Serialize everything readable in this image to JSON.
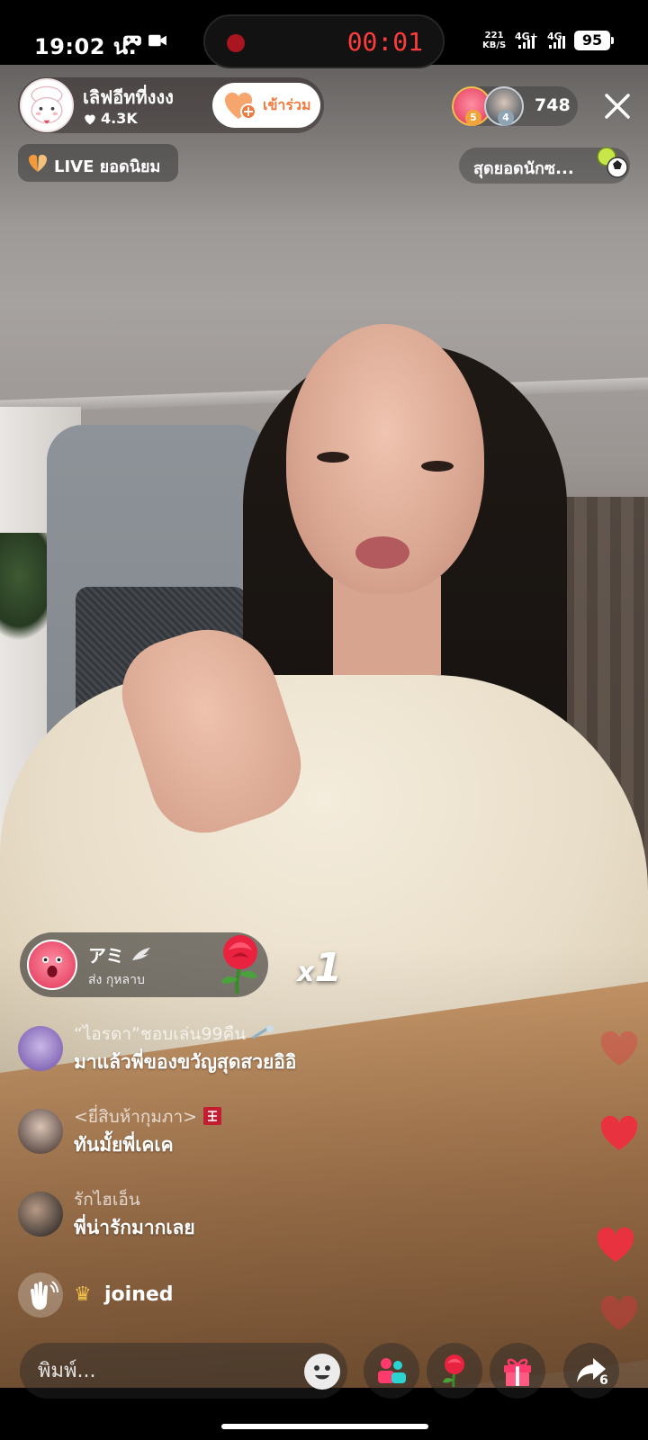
{
  "status_bar": {
    "time": "19:02 น.",
    "recording_time": "00:01",
    "net_speed_value": "221",
    "net_speed_unit": "KB/S",
    "sim1_label": "4G+",
    "sim2_label": "4G",
    "battery": "95"
  },
  "host": {
    "name": "เลิฟอีทที่งงง",
    "likes": "4.3K",
    "join_label": "เข้าร่วม"
  },
  "viewers": {
    "top_viewers": [
      {
        "rank": "5",
        "color": "#e94e6c"
      },
      {
        "rank": "4",
        "color": "#7a8a94"
      }
    ],
    "count": "748"
  },
  "live_badge": {
    "label": "LIVE ยอดนิยม"
  },
  "ranking_chip": {
    "label": "สุดยอดนักซ..."
  },
  "gift": {
    "sender": "アミ",
    "description": "ส่ง กุหลาบ",
    "multiplier": "x",
    "count": "1"
  },
  "comments": [
    {
      "user": "“ไอรดา”ชอบเล่น99คืน",
      "text": "มาแล้วพี่ของขวัญสุดสวยอิอิ"
    },
    {
      "user": "<ยี่สิบห้ากุมภา>",
      "text": "ทันมั้ยพี่เคเค"
    },
    {
      "user": "รักไฮเอ็น",
      "text": "พี่น่ารักมากเลย"
    }
  ],
  "joined": {
    "text": "joined"
  },
  "toolbar": {
    "input_placeholder": "พิมพ์...",
    "share_count": "6"
  },
  "colors": {
    "accent_orange": "#f07a3e",
    "heart_red": "#e8323f",
    "gift_pink": "#ff3b6e"
  }
}
